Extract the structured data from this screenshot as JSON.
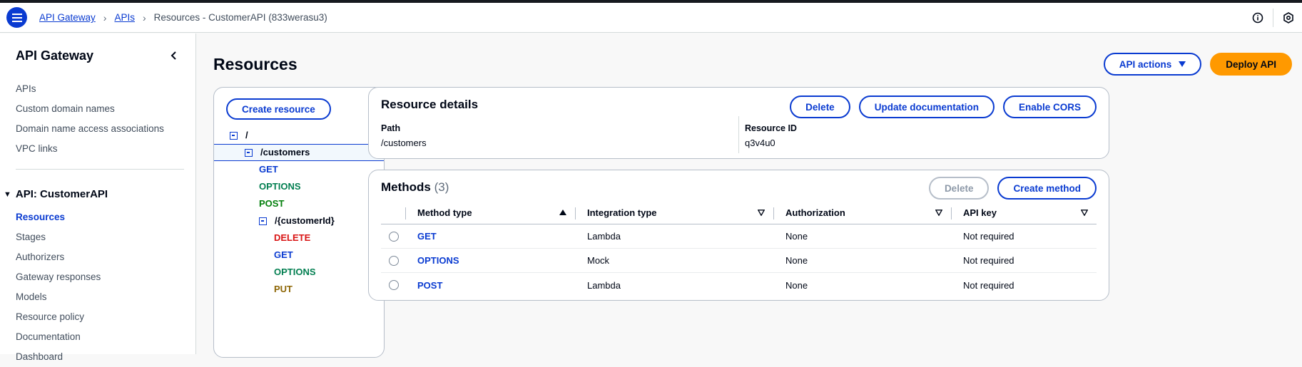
{
  "breadcrumb": {
    "items": [
      {
        "label": "API Gateway"
      },
      {
        "label": "APIs"
      }
    ],
    "current": "Resources - CustomerAPI (833werasu3)"
  },
  "topbar": {
    "icons": [
      "info-icon",
      "settings-hex-icon",
      "menu-icon"
    ]
  },
  "sidebar": {
    "title": "API Gateway",
    "links": [
      "APIs",
      "Custom domain names",
      "Domain name access associations",
      "VPC links"
    ],
    "api_section": "API: CustomerAPI",
    "api_links": [
      "Resources",
      "Stages",
      "Authorizers",
      "Gateway responses",
      "Models",
      "Resource policy",
      "Documentation",
      "Dashboard"
    ],
    "active": "Resources"
  },
  "page": {
    "title": "Resources",
    "api_actions_label": "API actions",
    "deploy_label": "Deploy API"
  },
  "tree": {
    "create_resource_label": "Create resource",
    "nodes": [
      {
        "label": "/",
        "kind": "resource"
      },
      {
        "label": "/customers",
        "kind": "resource",
        "selected": true
      },
      {
        "label": "GET",
        "kind": "method"
      },
      {
        "label": "OPTIONS",
        "kind": "method"
      },
      {
        "label": "POST",
        "kind": "method"
      },
      {
        "label": "/{customerId}",
        "kind": "resource"
      },
      {
        "label": "DELETE",
        "kind": "method"
      },
      {
        "label": "GET",
        "kind": "method"
      },
      {
        "label": "OPTIONS",
        "kind": "method"
      },
      {
        "label": "PUT",
        "kind": "method"
      }
    ]
  },
  "details": {
    "title": "Resource details",
    "delete_label": "Delete",
    "update_doc_label": "Update documentation",
    "cors_label": "Enable CORS",
    "path_key": "Path",
    "path_value": "/customers",
    "id_key": "Resource ID",
    "id_value": "q3v4u0"
  },
  "methods": {
    "title": "Methods",
    "count": "(3)",
    "delete_label": "Delete",
    "create_label": "Create method",
    "columns": [
      "Method type",
      "Integration type",
      "Authorization",
      "API key"
    ],
    "rows": [
      {
        "method": "GET",
        "integration": "Lambda",
        "authorization": "None",
        "api_key": "Not required"
      },
      {
        "method": "OPTIONS",
        "integration": "Mock",
        "authorization": "None",
        "api_key": "Not required"
      },
      {
        "method": "POST",
        "integration": "Lambda",
        "authorization": "None",
        "api_key": "Not required"
      }
    ]
  },
  "colors": {
    "accent": "#0a3bd1",
    "deploy": "#ff9900",
    "get": "#0a3bd1",
    "options": "#037f51",
    "post": "#037f0c",
    "delete": "#d91515",
    "put": "#8d6605"
  }
}
